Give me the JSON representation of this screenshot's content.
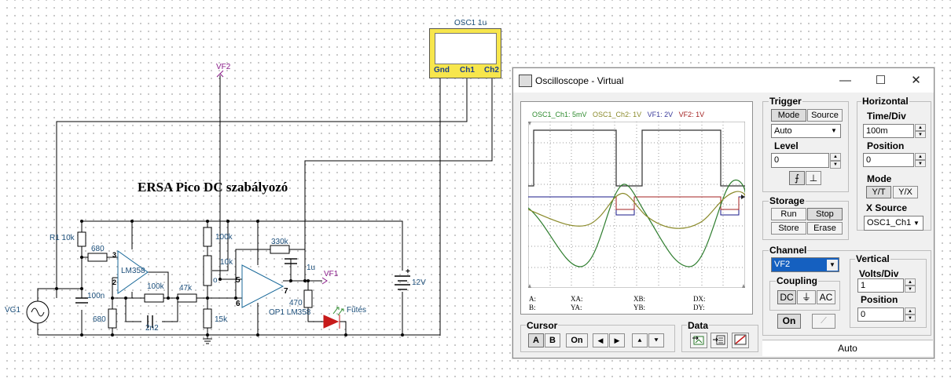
{
  "schematic": {
    "title": "ERSA Pico DC szabályozó",
    "probe_vf2": "VF2",
    "probe_vf1": "VF1",
    "labels": {
      "r1": "R1 10k",
      "r680a": "680",
      "r680b": "680",
      "c100n": "100n",
      "opamp1": "LM358",
      "r100k_fb": "100k",
      "c2n2": "2n2",
      "r47k": "47k",
      "r100k_top": "100k",
      "pot10k": "10k",
      "pot_o": "o",
      "r15k": "15k",
      "r330k": "330k",
      "c1u": "1u",
      "pin5": "5",
      "pin6": "6",
      "pin7": "7",
      "pin2": "2",
      "pin3": "3",
      "r470": "470",
      "opamp2": "OP1 LM358",
      "led": "Fűtés",
      "vcc": "12V",
      "vg1": "VG1",
      "plus": "+"
    },
    "osc_symbol": {
      "name": "OSC1 1u",
      "pins": [
        "Gnd",
        "Ch1",
        "Ch2"
      ]
    }
  },
  "window": {
    "title": "Oscilloscope - Virtual",
    "minimize": "—",
    "maximize": "☐",
    "close": "✕",
    "screen": {
      "legend": [
        {
          "text": "OSC1_Ch1: 5mV",
          "color": "#2e8b2e"
        },
        {
          "text": "OSC1_Ch2: 1V",
          "color": "#8a8a2a"
        },
        {
          "text": "VF1: 2V",
          "color": "#3a3a9a"
        },
        {
          "text": "VF2: 1V",
          "color": "#a32020"
        }
      ],
      "readouts": {
        "a": "A:",
        "b": "B:",
        "xa": "XA:",
        "ya": "YA:",
        "xb": "XB:",
        "yb": "YB:",
        "dx": "DX:",
        "dy": "DY:"
      }
    },
    "trigger": {
      "label": "Trigger",
      "mode": "Mode",
      "source": "Source",
      "mode_value": "Auto",
      "level_label": "Level",
      "level_value": "0",
      "rise_icon": "rising-edge",
      "fall_icon": "falling-edge"
    },
    "horizontal": {
      "label": "Horizontal",
      "timediv_label": "Time/Div",
      "timediv_value": "100m",
      "position_label": "Position",
      "position_value": "0",
      "mode_label": "Mode",
      "yt": "Y/T",
      "yx": "Y/X",
      "xsource_label": "X Source",
      "xsource_value": "OSC1_Ch1"
    },
    "storage": {
      "label": "Storage",
      "run": "Run",
      "stop": "Stop",
      "store": "Store",
      "erase": "Erase"
    },
    "channel": {
      "label": "Channel",
      "value": "VF2",
      "coupling_label": "Coupling",
      "dc": "DC",
      "gnd": "⏚",
      "ac": "AC",
      "on": "On",
      "color_icon": "pen-icon"
    },
    "vertical": {
      "label": "Vertical",
      "voltsdiv_label": "Volts/Div",
      "voltsdiv_value": "1",
      "position_label": "Position",
      "position_value": "0"
    },
    "cursor": {
      "label": "Cursor",
      "a": "A",
      "b": "B",
      "on": "On",
      "left": "◀",
      "right": "▶",
      "up": "⯅",
      "down": "⯆"
    },
    "data": {
      "label": "Data"
    },
    "status": "Auto"
  }
}
